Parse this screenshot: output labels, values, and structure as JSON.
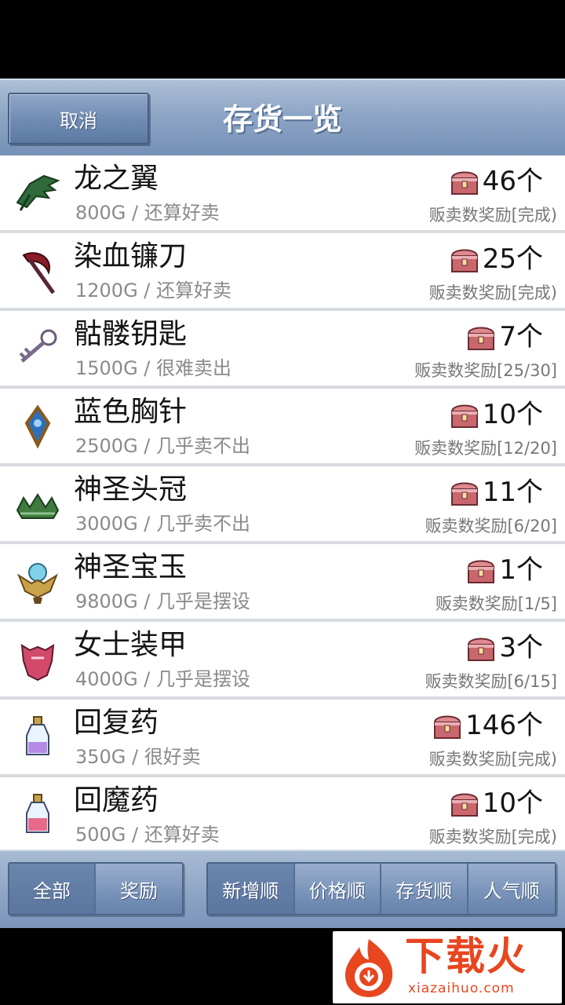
{
  "header": {
    "cancel_label": "取消",
    "title": "存货一览"
  },
  "items": [
    {
      "name": "龙之翼",
      "sub": "800G / 还算好卖",
      "count": "46个",
      "reward": "贩卖数奖励[完成)",
      "icon": "dragon-wing-icon"
    },
    {
      "name": "染血镰刀",
      "sub": "1200G / 还算好卖",
      "count": "25个",
      "reward": "贩卖数奖励[完成)",
      "icon": "bloody-scythe-icon"
    },
    {
      "name": "骷髅钥匙",
      "sub": "1500G / 很难卖出",
      "count": "7个",
      "reward": "贩卖数奖励[25/30]",
      "icon": "skull-key-icon"
    },
    {
      "name": "蓝色胸针",
      "sub": "2500G / 几乎卖不出",
      "count": "10个",
      "reward": "贩卖数奖励[12/20]",
      "icon": "blue-brooch-icon"
    },
    {
      "name": "神圣头冠",
      "sub": "3000G / 几乎卖不出",
      "count": "11个",
      "reward": "贩卖数奖励[6/20]",
      "icon": "holy-crown-icon"
    },
    {
      "name": "神圣宝玉",
      "sub": "9800G / 几乎是摆设",
      "count": "1个",
      "reward": "贩卖数奖励[1/5]",
      "icon": "holy-jewel-icon"
    },
    {
      "name": "女士装甲",
      "sub": "4000G / 几乎是摆设",
      "count": "3个",
      "reward": "贩卖数奖励[6/15]",
      "icon": "lady-armor-icon"
    },
    {
      "name": "回复药",
      "sub": "350G / 很好卖",
      "count": "146个",
      "reward": "贩卖数奖励[完成)",
      "icon": "healing-potion-icon"
    },
    {
      "name": "回魔药",
      "sub": "500G / 还算好卖",
      "count": "10个",
      "reward": "贩卖数奖励[完成)",
      "icon": "mana-potion-icon"
    }
  ],
  "footer": {
    "filter_tabs": [
      "全部",
      "奖励"
    ],
    "sort_tabs": [
      "新增顺",
      "价格顺",
      "存货顺",
      "人气顺"
    ]
  },
  "watermark": {
    "text": "下载火",
    "sub": "xiazaihuo.com"
  },
  "colors": {
    "header_blue": "#8ea6c6",
    "chest_red": "#c9676e",
    "watermark_orange": "#e8461f"
  }
}
